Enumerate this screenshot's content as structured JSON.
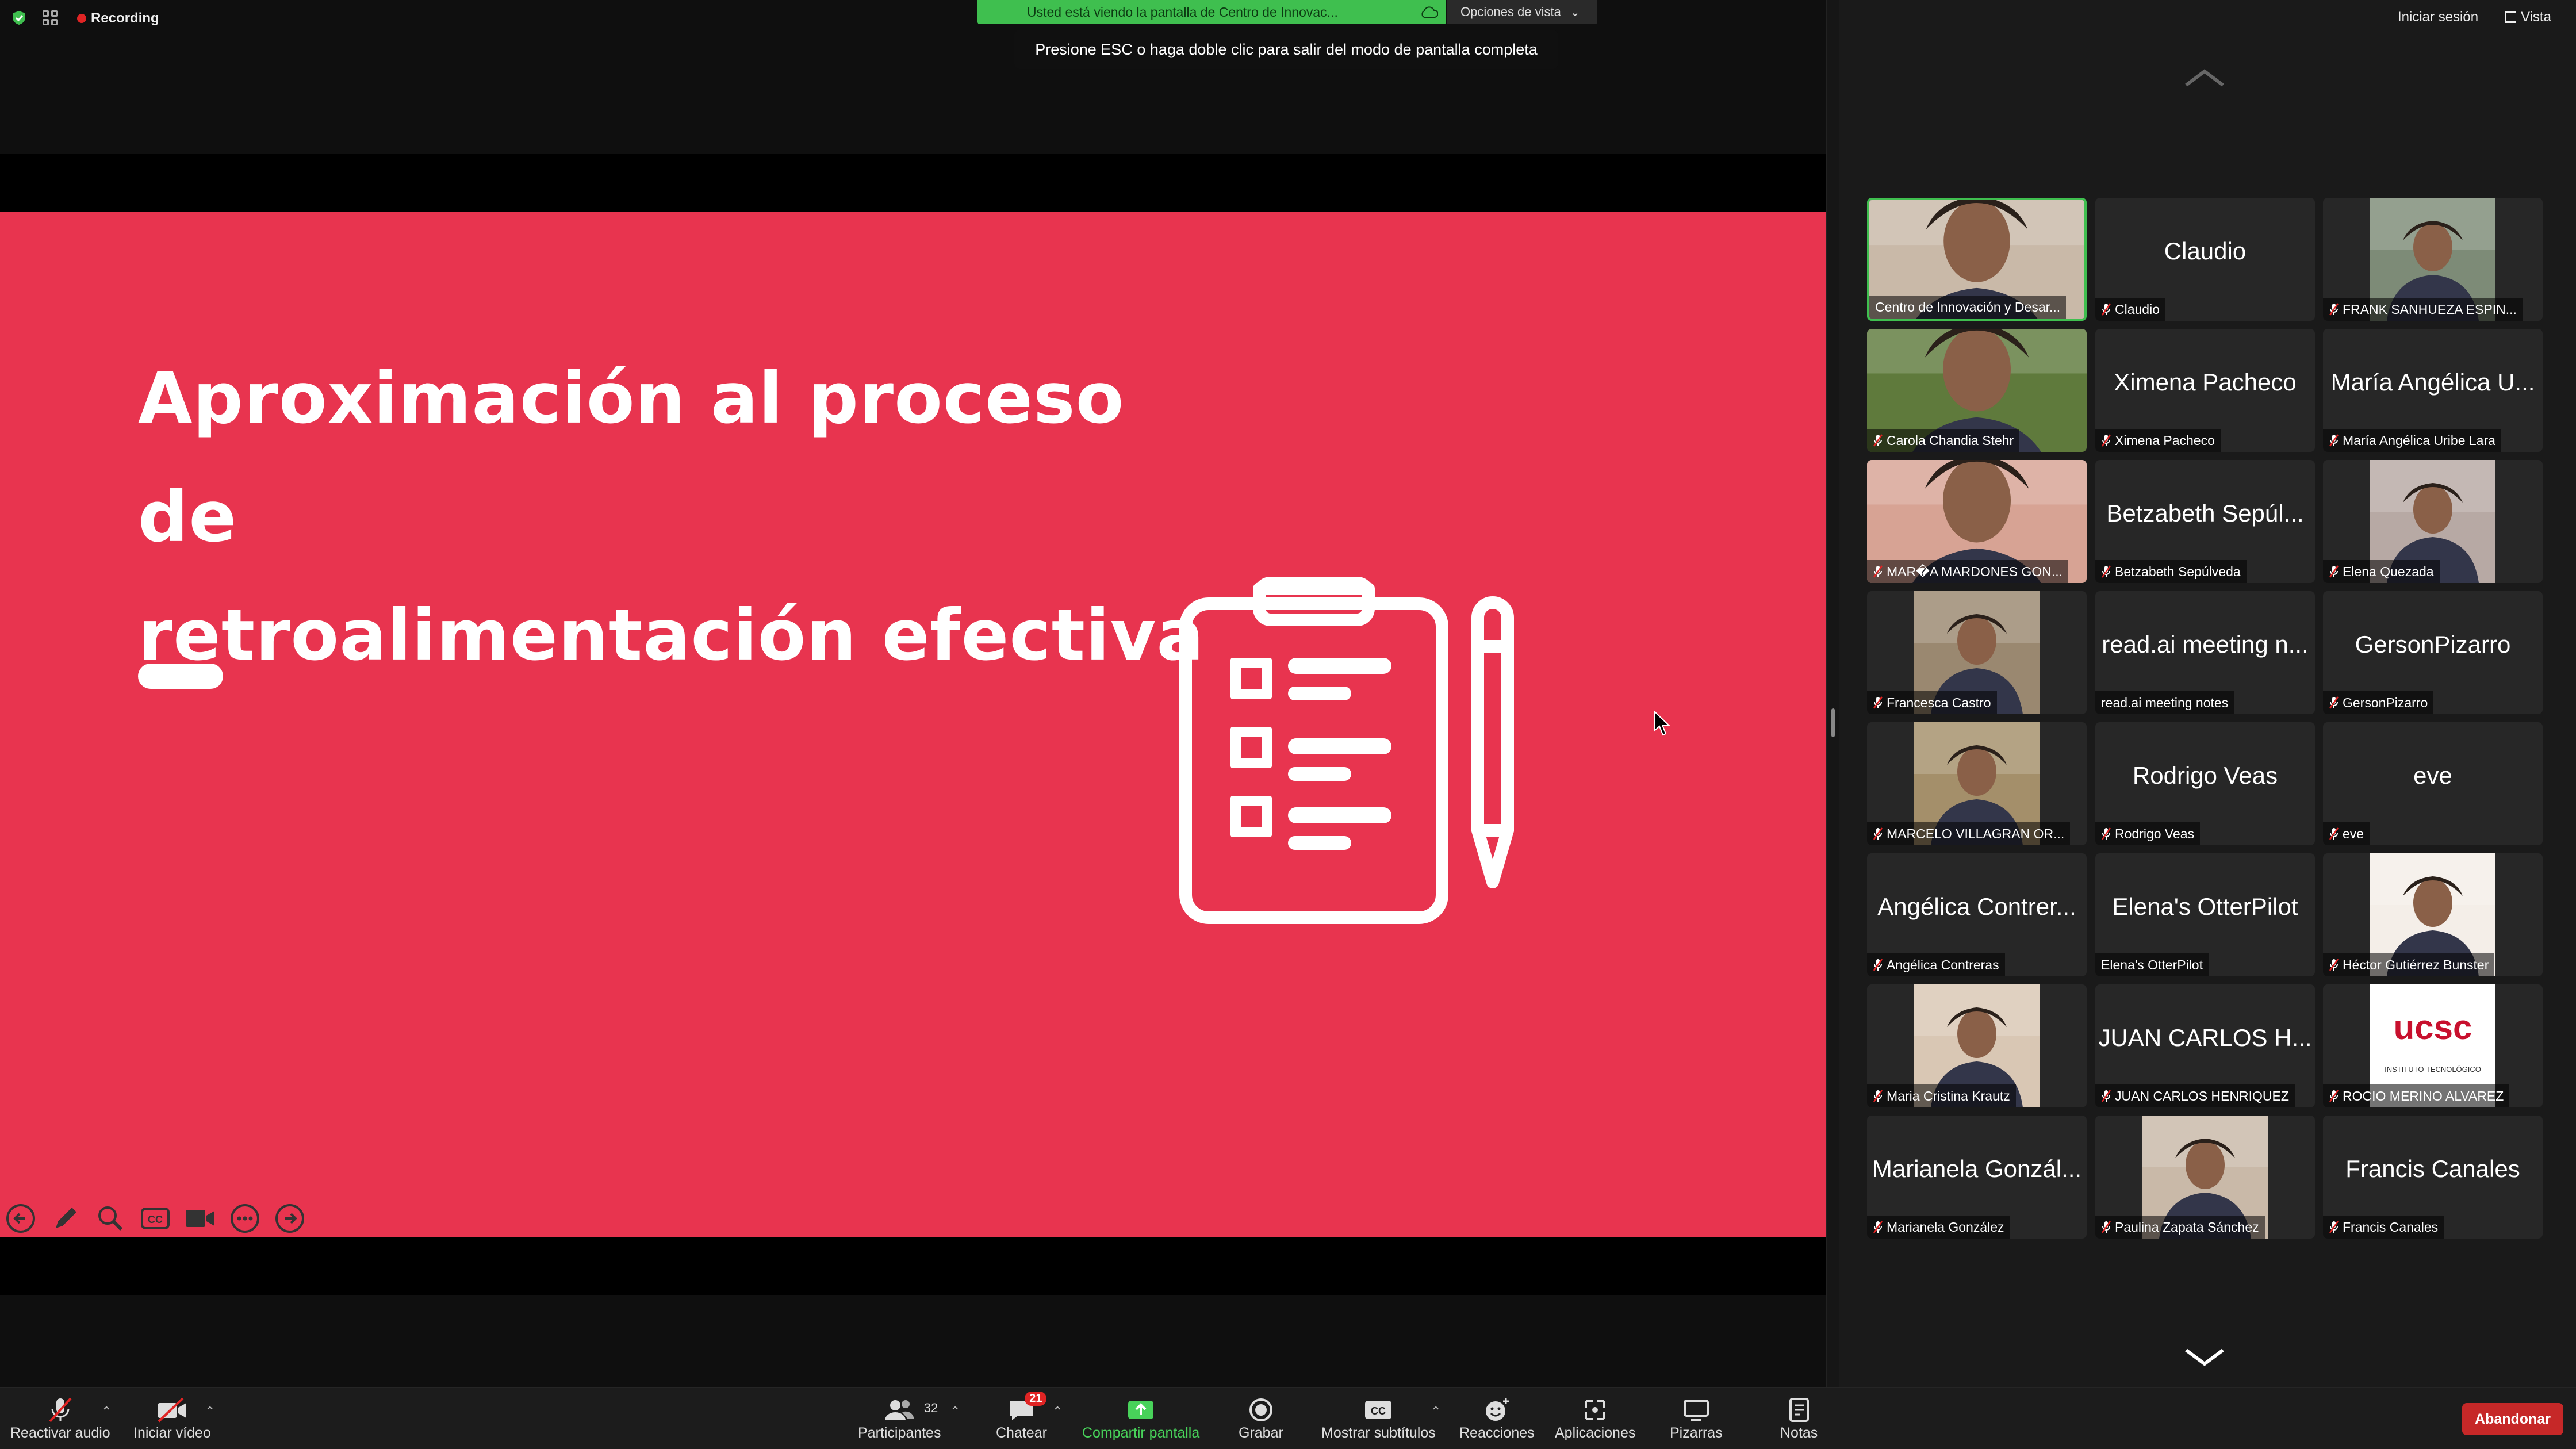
{
  "top": {
    "recording_label": "Recording",
    "viewing_text": "Usted está viendo la pantalla de Centro de Innovac...",
    "view_options_label": "Opciones de vista",
    "esc_tip": "Presione ESC o haga doble clic para salir del modo de pantalla completa",
    "sign_in_label": "Iniciar sesión",
    "view_label": "Vista"
  },
  "slide": {
    "title_line1": "Aproximación al proceso de",
    "title_line2": "retroalimentación efectiva",
    "background": "#e8344f"
  },
  "participants": [
    {
      "display": "photo",
      "label": "Centro de Innovación y Desar...",
      "active": true,
      "muted": false
    },
    {
      "display": "name",
      "big": "Claudio",
      "label": "Claudio",
      "muted": true
    },
    {
      "display": "photo",
      "label": "FRANK SANHUEZA ESPIN...",
      "muted": true
    },
    {
      "display": "photo",
      "label": "Carola Chandia Stehr",
      "muted": true
    },
    {
      "display": "name",
      "big": "Ximena Pacheco",
      "label": "Ximena Pacheco",
      "muted": true
    },
    {
      "display": "name",
      "big": "María Angélica U...",
      "label": "María Angélica Uribe Lara",
      "muted": true
    },
    {
      "display": "photo",
      "label": "MAR�A MARDONES GON...",
      "muted": true
    },
    {
      "display": "name",
      "big": "Betzabeth Sepúl...",
      "label": "Betzabeth Sepúlveda",
      "muted": true
    },
    {
      "display": "photo",
      "label": "Elena Quezada",
      "muted": true
    },
    {
      "display": "photo",
      "label": "Francesca Castro",
      "muted": true
    },
    {
      "display": "name",
      "big": "read.ai meeting n...",
      "label": "read.ai meeting notes",
      "muted": false
    },
    {
      "display": "name",
      "big": "GersonPizarro",
      "label": "GersonPizarro",
      "muted": true
    },
    {
      "display": "photo",
      "label": "MARCELO VILLAGRAN OR...",
      "muted": true
    },
    {
      "display": "name",
      "big": "Rodrigo Veas",
      "label": "Rodrigo Veas",
      "muted": true
    },
    {
      "display": "name",
      "big": "eve",
      "label": "eve",
      "muted": true
    },
    {
      "display": "name",
      "big": "Angélica Contrer...",
      "label": "Angélica Contreras",
      "muted": true
    },
    {
      "display": "name",
      "big": "Elena's OtterPilot",
      "label": "Elena's OtterPilot",
      "muted": false
    },
    {
      "display": "photo",
      "label": "Héctor Gutiérrez Bunster",
      "muted": true
    },
    {
      "display": "photo",
      "label": "Maria Cristina Krautz",
      "muted": true
    },
    {
      "display": "name",
      "big": "JUAN CARLOS H...",
      "label": "JUAN CARLOS HENRIQUEZ",
      "muted": true
    },
    {
      "display": "logo",
      "label": "ROCIO MERINO ALVAREZ",
      "muted": true,
      "logo_text": "ucsc",
      "logo_sub": "INSTITUTO TECNOLÓGICO"
    },
    {
      "display": "name",
      "big": "Marianela Gonzál...",
      "label": "Marianela González",
      "muted": true
    },
    {
      "display": "photo",
      "label": "Paulina Zapata Sánchez",
      "muted": true
    },
    {
      "display": "name",
      "big": "Francis Canales",
      "label": "Francis Canales",
      "muted": true
    }
  ],
  "toolbar": {
    "unmute_label": "Reactivar audio",
    "start_video_label": "Iniciar vídeo",
    "participants_label": "Participantes",
    "participants_count": "32",
    "chat_label": "Chatear",
    "chat_badge": "21",
    "share_label": "Compartir pantalla",
    "record_label": "Grabar",
    "captions_label": "Mostrar subtítulos",
    "reactions_label": "Reacciones",
    "apps_label": "Aplicaciones",
    "whiteboards_label": "Pizarras",
    "notes_label": "Notas",
    "leave_label": "Abandonar"
  },
  "colors": {
    "accent_green": "#3fbf4f",
    "leave_red": "#c62828",
    "badge_red": "#e02424"
  }
}
